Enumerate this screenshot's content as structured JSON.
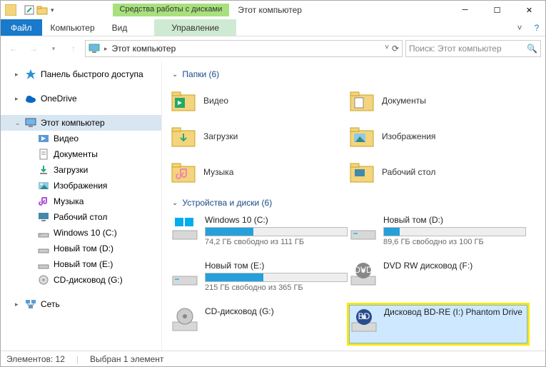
{
  "titlebar": {
    "tab_extra": "Средства работы с дисками",
    "title": "Этот компьютер"
  },
  "ribbon": {
    "file": "Файл",
    "computer": "Компьютер",
    "view": "Вид",
    "manage": "Управление"
  },
  "addr": {
    "crumb": "Этот компьютер",
    "search_placeholder": "Поиск: Этот компьютер"
  },
  "nav": {
    "quick": "Панель быстрого доступа",
    "onedrive": "OneDrive",
    "thispc": "Этот компьютер",
    "video": "Видео",
    "documents": "Документы",
    "downloads": "Загрузки",
    "pictures": "Изображения",
    "music": "Музыка",
    "desktop": "Рабочий стол",
    "win10": "Windows 10 (C:)",
    "voltD": "Новый том (D:)",
    "voltE": "Новый том (E:)",
    "cdG": "CD-дисковод (G:)",
    "network": "Сеть"
  },
  "groups": {
    "folders": "Папки (6)",
    "devices": "Устройства и диски (6)"
  },
  "folders": {
    "video": "Видео",
    "documents": "Документы",
    "downloads": "Загрузки",
    "pictures": "Изображения",
    "music": "Музыка",
    "desktop": "Рабочий стол"
  },
  "drives": {
    "c": {
      "name": "Windows 10 (C:)",
      "free": "74,2 ГБ свободно из 111 ГБ",
      "fill": 34
    },
    "d": {
      "name": "Новый том (D:)",
      "free": "89,6 ГБ свободно из 100 ГБ",
      "fill": 11
    },
    "e": {
      "name": "Новый том (E:)",
      "free": "215 ГБ свободно из 365 ГБ",
      "fill": 41
    },
    "f": {
      "name": "DVD RW дисковод (F:)"
    },
    "g": {
      "name": "CD-дисковод (G:)"
    },
    "i": {
      "name": "Дисковод BD-RE (I:) Phantom Drive"
    }
  },
  "status": {
    "count": "Элементов: 12",
    "selected": "Выбран 1 элемент"
  }
}
